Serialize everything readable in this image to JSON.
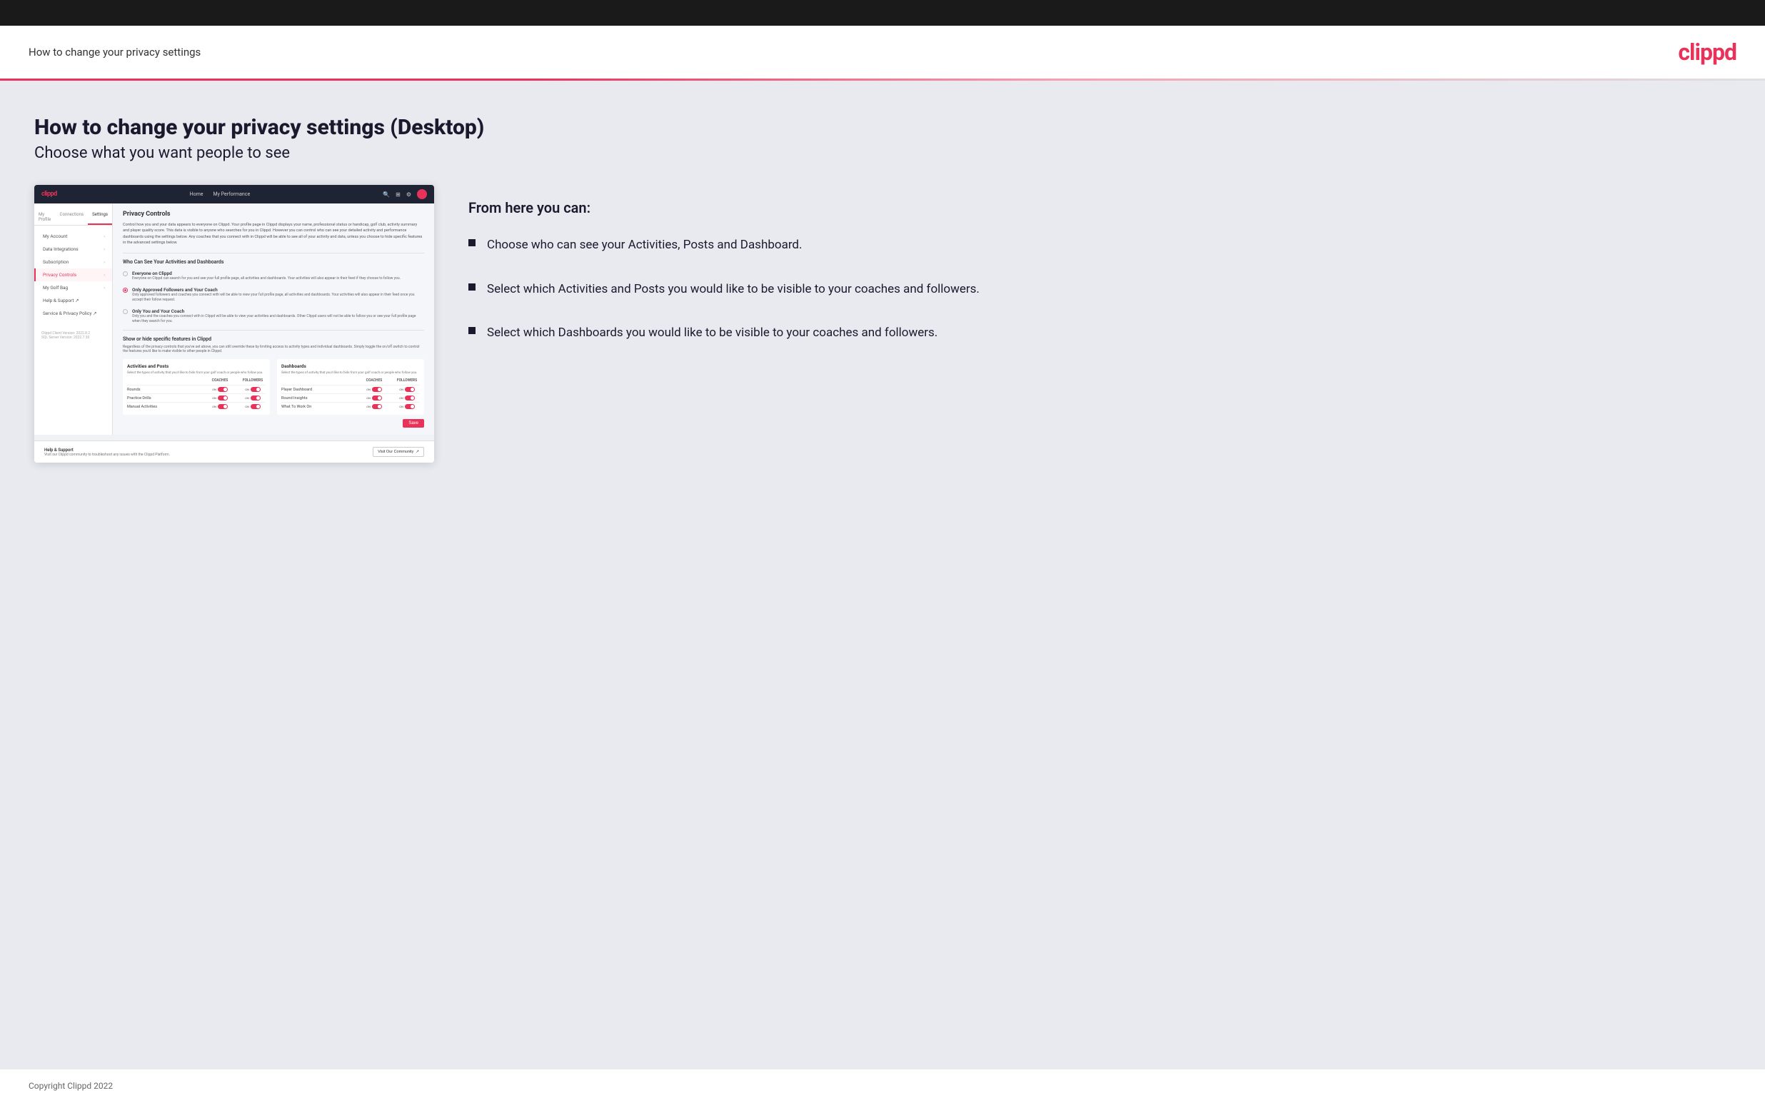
{
  "header": {
    "title": "How to change your privacy settings",
    "logo": "clippd"
  },
  "page": {
    "heading": "How to change your privacy settings (Desktop)",
    "subheading": "Choose what you want people to see"
  },
  "info": {
    "from_here": "From here you can:",
    "bullets": [
      "Choose who can see your Activities, Posts and Dashboard.",
      "Select which Activities and Posts you would like to be visible to your coaches and followers.",
      "Select which Dashboards you would like to be visible to your coaches and followers."
    ]
  },
  "mockup": {
    "nav": [
      "Home",
      "My Performance"
    ],
    "sidebar_tabs": [
      "My Profile",
      "Connections",
      "Settings"
    ],
    "sidebar_items": [
      {
        "label": "My Account",
        "active": false
      },
      {
        "label": "Data Integrations",
        "active": false
      },
      {
        "label": "Subscription",
        "active": false
      },
      {
        "label": "Privacy Controls",
        "active": true
      },
      {
        "label": "My Golf Bag",
        "active": false
      },
      {
        "label": "Help & Support",
        "active": false
      },
      {
        "label": "Service & Privacy Policy",
        "active": false
      }
    ],
    "version": "Clippd Client Version: 2022.8.2\nSQL Server Version: 2022.7.30",
    "section_title": "Privacy Controls",
    "section_desc": "Control how you and your data appears to everyone on Clippd. Your profile page in Clippd displays your name, professional status or handicap, golf club, activity summary and player quality score. This data is visible to anyone who searches for you in Clippd. However you can control who can see your detailed activity and performance dashboards using the settings below. Any coaches that you connect with in Clippd will be able to see all of your activity and data, unless you choose to hide specific features in the advanced settings below.",
    "who_section_title": "Who Can See Your Activities and Dashboards",
    "radio_options": [
      {
        "label": "Everyone on Clippd",
        "desc": "Everyone on Clippd can search for you and see your full profile page, all activities and dashboards. Your activities will also appear in their feed if they choose to follow you.",
        "selected": false
      },
      {
        "label": "Only Approved Followers and Your Coach",
        "desc": "Only approved followers and coaches you connect with will be able to view your full profile page, all activities and dashboards. Your activities will also appear in their feed once you accept their follow request.",
        "selected": true
      },
      {
        "label": "Only You and Your Coach",
        "desc": "Only you and the coaches you connect with in Clippd will be able to view your activities and dashboards. Other Clippd users will not be able to follow you or see your full profile page when they search for you.",
        "selected": false
      }
    ],
    "show_hide_title": "Show or hide specific features in Clippd",
    "show_hide_desc": "Regardless of the privacy controls that you've set above, you can still override these by limiting access to activity types and individual dashboards. Simply toggle the on/off switch to control the features you'd like to make visible to other people in Clippd.",
    "activities_table": {
      "title": "Activities and Posts",
      "desc": "Select the types of activity that you'd like to hide from your golf coach or people who follow you.",
      "col_headers": [
        "COACHES",
        "FOLLOWERS"
      ],
      "rows": [
        {
          "label": "Rounds"
        },
        {
          "label": "Practice Drills"
        },
        {
          "label": "Manual Activities"
        }
      ]
    },
    "dashboards_table": {
      "title": "Dashboards",
      "desc": "Select the types of activity that you'd like to hide from your golf coach or people who follow you.",
      "col_headers": [
        "COACHES",
        "FOLLOWERS"
      ],
      "rows": [
        {
          "label": "Player Dashboard"
        },
        {
          "label": "Round Insights"
        },
        {
          "label": "What To Work On"
        }
      ]
    },
    "save_label": "Save",
    "help_title": "Help & Support",
    "help_desc": "Visit our Clippd community to troubleshoot any issues with the Clippd Platform.",
    "visit_btn": "Visit Our Community"
  },
  "footer": {
    "copyright": "Copyright Clippd 2022"
  }
}
